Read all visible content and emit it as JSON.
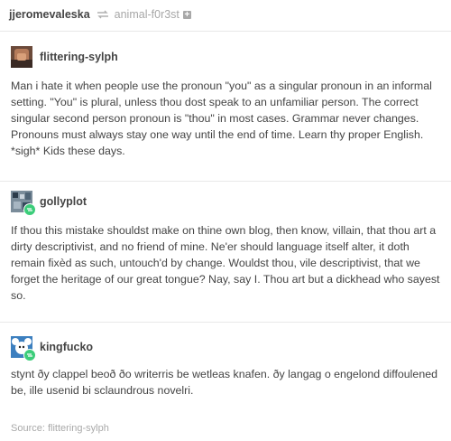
{
  "header": {
    "username": "jjeromevaleska",
    "reblog_icon": "reblog-icon",
    "source_blog": "animal-f0r3st",
    "follow_icon": "plus-icon"
  },
  "posts": [
    {
      "username": "flittering-sylph",
      "avatar_icon": "avatar-photo",
      "text": "Man i hate it when people use the pronoun \"you\" as a singular pronoun in an informal setting. \"You\" is plural, unless thou dost speak to an unfamiliar person. The correct singular second person pronoun is \"thou\" in most cases. Grammar never changes. Pronouns must always stay one way until the end of time. Learn thy proper English. *sigh* Kids these days."
    },
    {
      "username": "gollyplot",
      "avatar_icon": "avatar-pixel-art",
      "text": "If thou this mistake shouldst make on thine own blog, then know, villain, that thou art a dirty descriptivist, and no friend of mine. Ne'er should language itself alter, it doth remain fixèd as such, untouch'd by change. Wouldst thou, vile descriptivist, that we forget the heritage of our great tongue? Nay, say I. Thou art but a dickhead who sayest so."
    },
    {
      "username": "kingfucko",
      "avatar_icon": "avatar-cartoon",
      "text": "stynt ðy clappel beoð ðo writerris be wetleas knafen. ðy langag o engelond diffoulened be, ille usenid bi sclaundrous novelri."
    }
  ],
  "source": "Source: flittering-sylph",
  "colors": {
    "text": "#444444",
    "muted": "#a9a9a9",
    "divider": "#e8e8e8",
    "badge_green": "#3ccd7a"
  }
}
